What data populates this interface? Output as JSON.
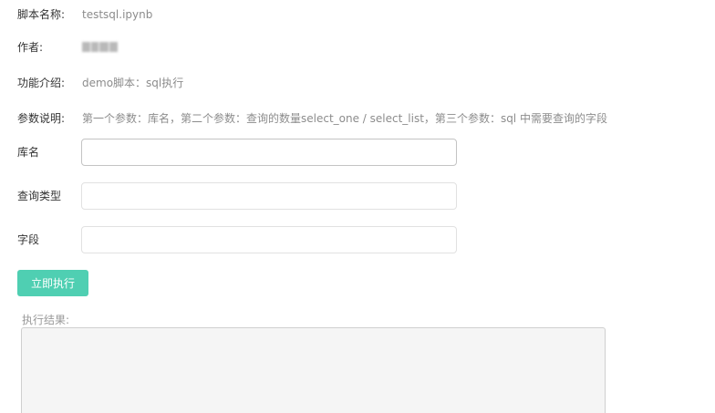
{
  "script_info": {
    "name_label": "脚本名称:",
    "name_value": "testsql.ipynb",
    "author_label": "作者:",
    "intro_label": "功能介绍:",
    "intro_value": "demo脚本：sql执行",
    "params_label": "参数说明:",
    "params_value": "第一个参数：库名，第二个参数：查询的数量select_one / select_list，第三个参数：sql 中需要查询的字段"
  },
  "form": {
    "fields": [
      {
        "label": "库名",
        "value": ""
      },
      {
        "label": "查询类型",
        "value": ""
      },
      {
        "label": "字段",
        "value": ""
      }
    ],
    "run_button_label": "立即执行"
  },
  "result": {
    "label": "执行结果:",
    "value": ""
  },
  "colors": {
    "accent": "#4fcfb2",
    "label_text": "#333333",
    "value_text": "#8c8c8c"
  }
}
